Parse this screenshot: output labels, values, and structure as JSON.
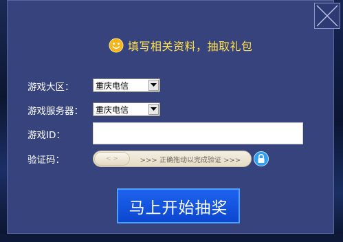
{
  "dialog": {
    "title": "填写相关资料，抽取礼包",
    "icons": {
      "close": "close-x-icon",
      "smiley": "smiley-face-icon",
      "lock": "lock-icon"
    }
  },
  "form": {
    "region": {
      "label": "游戏大区：",
      "value": "重庆电信"
    },
    "server": {
      "label": "游戏服务器：",
      "value": "重庆电信"
    },
    "game_id": {
      "label": "游戏ID：",
      "value": ""
    },
    "captcha": {
      "label": "验证码：",
      "handle_text": "< >",
      "slider_text": ">>>  正确拖动以完成验证  >>>"
    }
  },
  "submit_label": "马上开始抽奖",
  "colors": {
    "dialog_bg": "#36437d",
    "title": "#ffe04a",
    "button": "#1d63ef"
  }
}
